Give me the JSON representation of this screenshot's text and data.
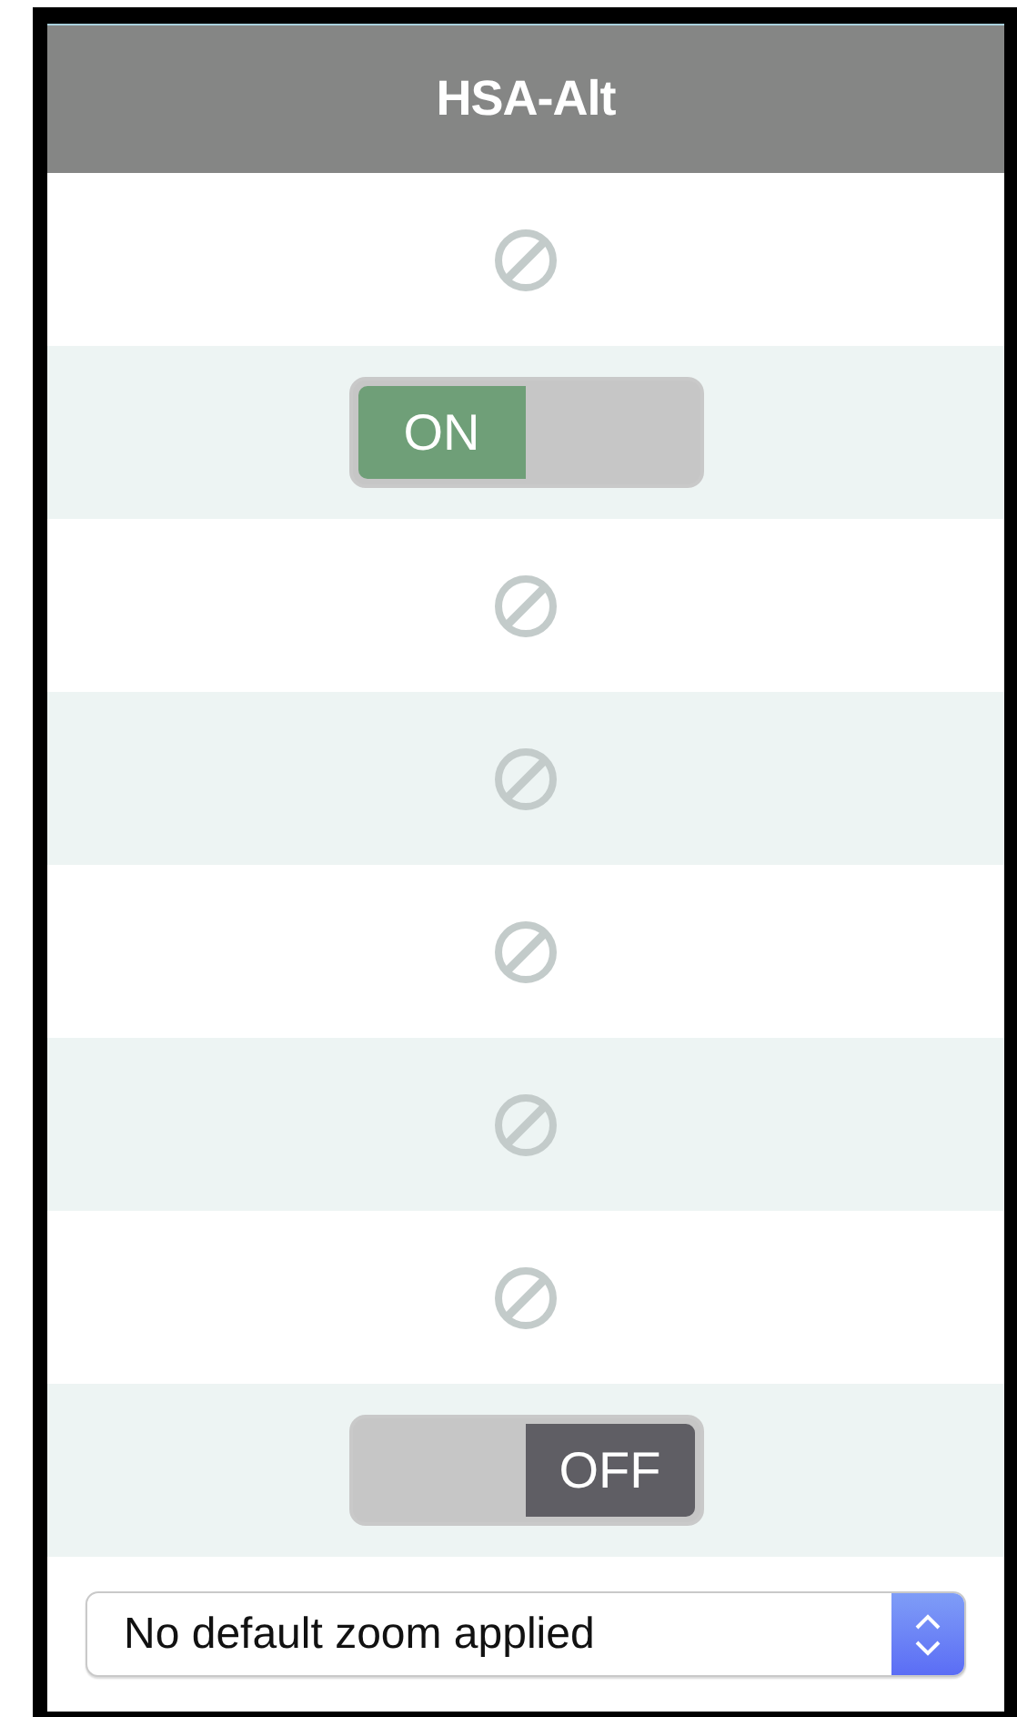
{
  "header": {
    "title": "HSA-Alt"
  },
  "rows": [
    {
      "kind": "blocked"
    },
    {
      "kind": "toggle",
      "on": true,
      "label": "ON"
    },
    {
      "kind": "blocked"
    },
    {
      "kind": "blocked"
    },
    {
      "kind": "blocked"
    },
    {
      "kind": "blocked"
    },
    {
      "kind": "blocked"
    },
    {
      "kind": "toggle",
      "on": false,
      "label": "OFF"
    }
  ],
  "zoom_select": {
    "value": "No default zoom applied"
  }
}
